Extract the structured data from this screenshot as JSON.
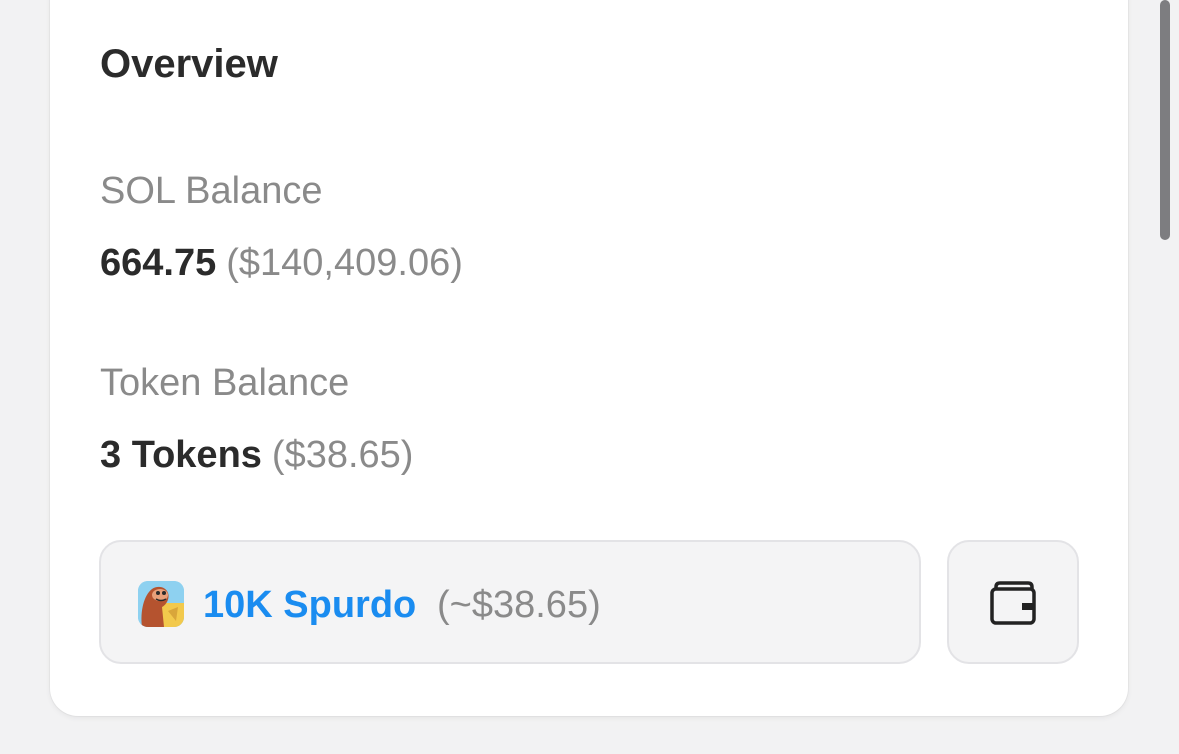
{
  "overview": {
    "title": "Overview",
    "sol_balance": {
      "label": "SOL Balance",
      "amount": "664.75",
      "usd": "($140,409.06)"
    },
    "token_balance": {
      "label": "Token Balance",
      "count": "3 Tokens",
      "usd": "($38.65)"
    },
    "token_item": {
      "name": "10K Spurdo",
      "value": "(~$38.65)",
      "icon": "token-avatar"
    },
    "wallet_button": {
      "icon": "wallet-icon"
    }
  },
  "colors": {
    "background": "#f2f2f3",
    "card": "#ffffff",
    "link": "#1a8cf0",
    "muted_text": "#8a8a8a",
    "primary_text": "#2b2b2b"
  }
}
